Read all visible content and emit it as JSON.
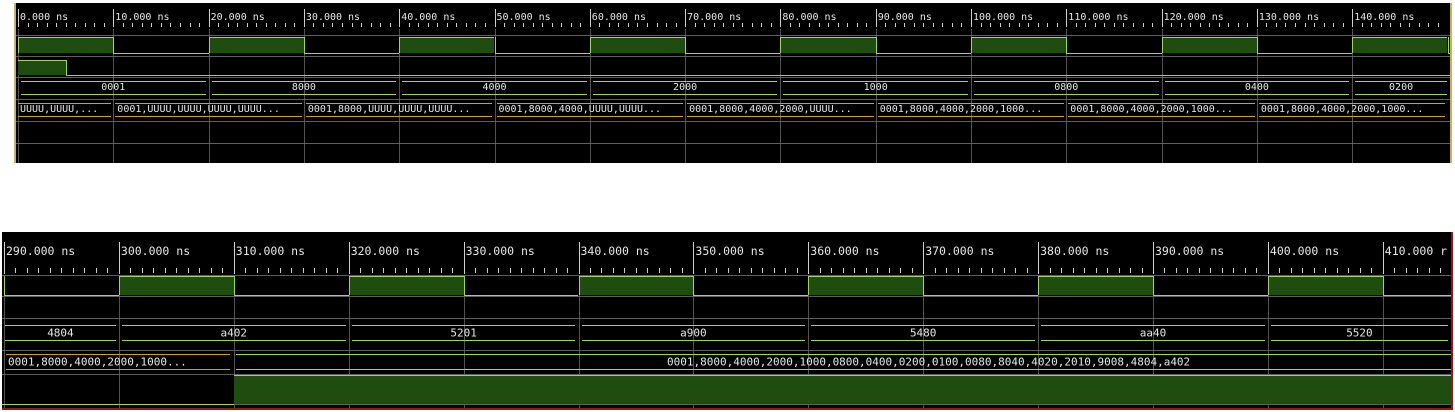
{
  "panel1": {
    "time_ticks": [
      "0.000 ns",
      "10.000 ns",
      "20.000 ns",
      "30.000 ns",
      "40.000 ns",
      "50.000 ns",
      "60.000 ns",
      "70.000 ns",
      "80.000 ns",
      "90.000 ns",
      "100.000 ns",
      "110.000 ns",
      "120.000 ns",
      "130.000 ns",
      "140.000 ns"
    ],
    "clock": {
      "high_ticks": [
        0,
        2,
        4,
        6,
        8,
        10,
        12,
        14
      ]
    },
    "reset": {
      "high_until_ns": 5
    },
    "bus_values": [
      "0001",
      "8000",
      "4000",
      "2000",
      "1000",
      "0800",
      "0400",
      "0200"
    ],
    "array_values": [
      "UUUU,UUUU,...",
      "0001,UUUU,UUUU,UUUU,UUUU...",
      "0001,8000,UUUU,UUUU,UUUU...",
      "0001,8000,4000,UUUU,UUUU...",
      "0001,8000,4000,2000,UUUU...",
      "0001,8000,4000,2000,1000...",
      "0001,8000,4000,2000,1000...",
      "0001,8000,4000,2000,1000..."
    ]
  },
  "panel2": {
    "time_ticks": [
      "290.000 ns",
      "300.000 ns",
      "310.000 ns",
      "320.000 ns",
      "330.000 ns",
      "340.000 ns",
      "350.000 ns",
      "360.000 ns",
      "370.000 ns",
      "380.000 ns",
      "390.000 ns",
      "400.000 ns",
      "410.000 r"
    ],
    "clock": {
      "high_ticks": [
        1,
        3,
        5,
        7,
        9,
        11
      ]
    },
    "bus_values": [
      "4804",
      "a402",
      "5201",
      "a900",
      "5480",
      "aa40",
      "5520"
    ],
    "array_values": [
      "0001,8000,4000,2000,1000...",
      "0001,8000,4000,2000,1000,0800,0400,0200,0100,0080,8040,4020,2010,9008,4804,a402"
    ],
    "done": {
      "high_from_tick": 2
    }
  }
}
